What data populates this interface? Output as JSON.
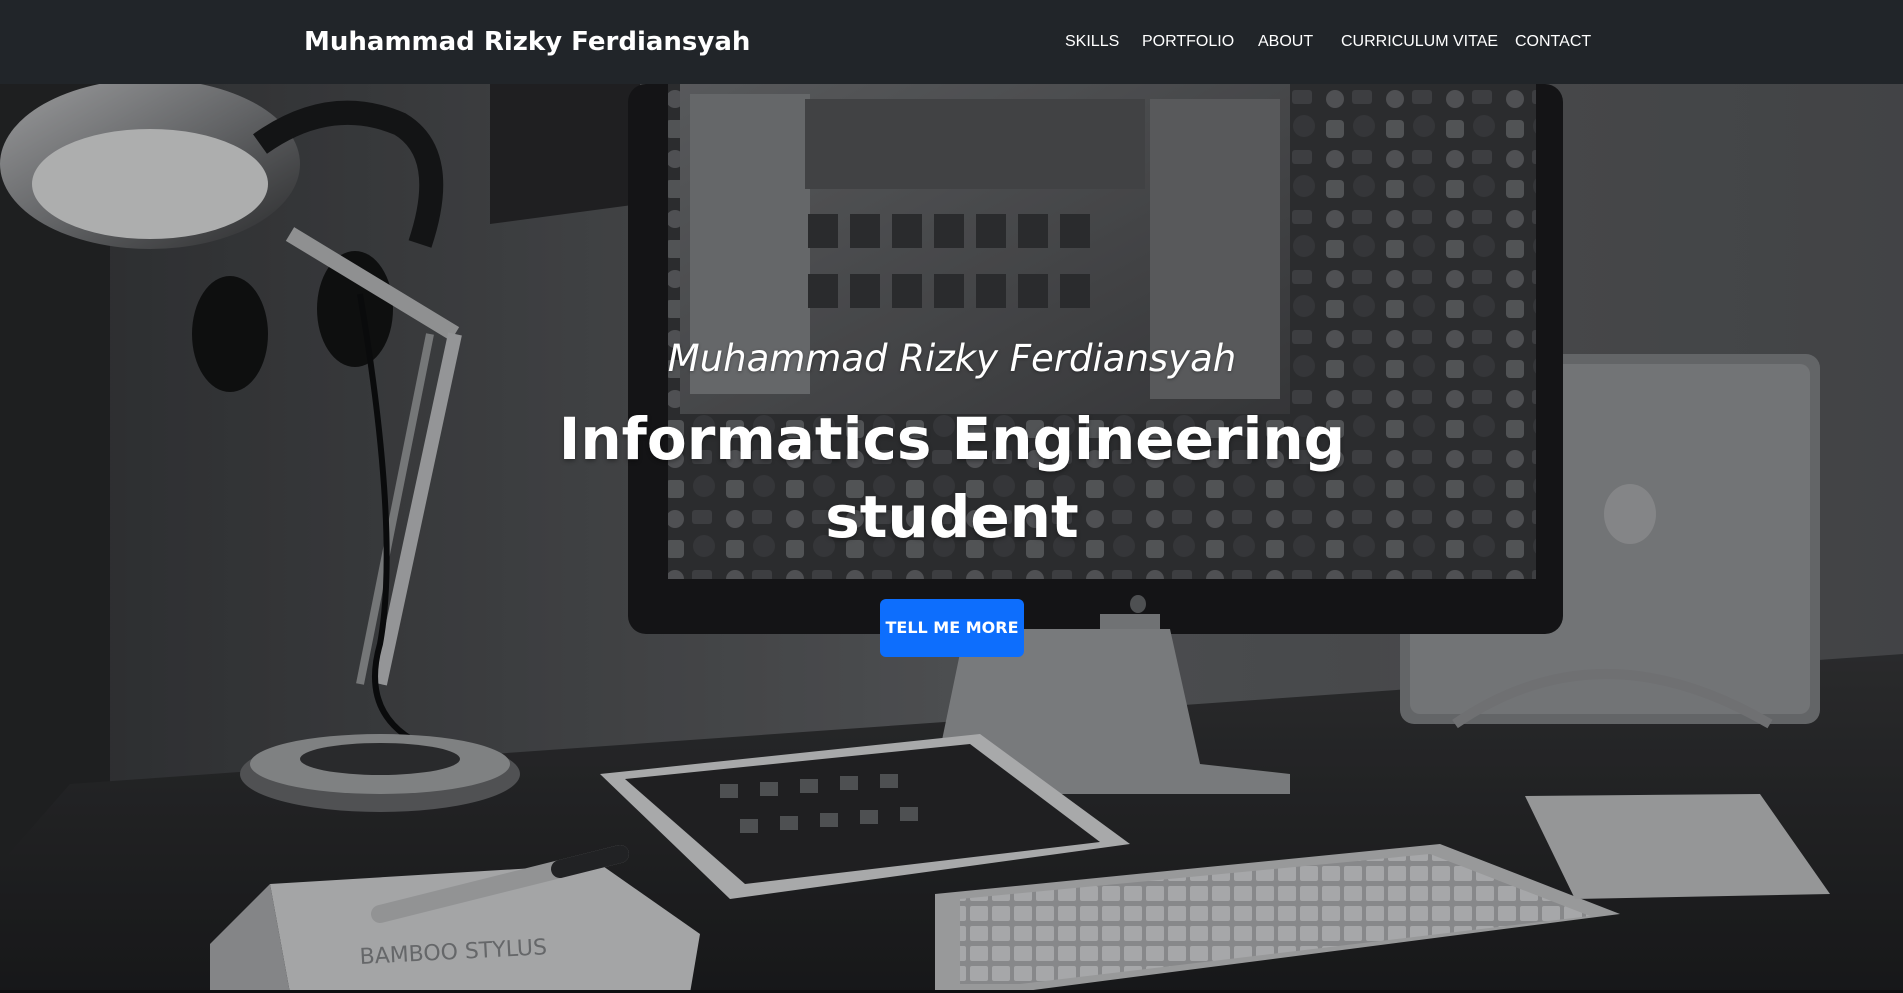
{
  "navbar": {
    "brand": "Muhammad Rizky Ferdiansyah",
    "links": [
      "SKILLS",
      "PORTFOLIO",
      "ABOUT",
      "CURRICULUM VITAE",
      "CONTACT"
    ]
  },
  "hero": {
    "subtitle": "Muhammad Rizky Ferdiansyah",
    "title": "Informatics Engineering student",
    "cta_label": "TELL ME MORE",
    "background_image": "desk-workspace-grayscale"
  },
  "colors": {
    "navbar_bg": "#212529",
    "cta_bg": "#0d6efd",
    "text": "#ffffff"
  },
  "box_text": "BAMBOO STYLUS"
}
